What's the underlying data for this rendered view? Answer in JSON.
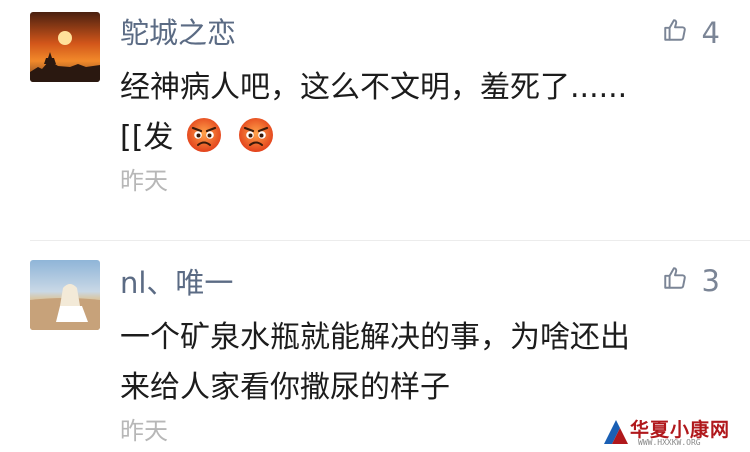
{
  "comments": [
    {
      "username": "鸵城之恋",
      "text_line1": "经神病人吧，这么不文明，羞死了......",
      "text_line2_prefix": "[[发",
      "emoji": [
        "angry-emoji",
        "angry-emoji"
      ],
      "time": "昨天",
      "like_count": "4"
    },
    {
      "username": "nl、唯一",
      "text_line1": "一个矿泉水瓶就能解决的事，为啥还出",
      "text_line2": "来给人家看你撒尿的样子",
      "time": "昨天",
      "like_count": "3"
    }
  ],
  "watermark": {
    "title": "华夏小康网",
    "url": "WWW.HXXKW.ORG"
  },
  "colors": {
    "username": "#5b6b84",
    "text": "#1c1c1c",
    "time": "#b7b7b7",
    "like": "#7b8596",
    "watermark": "#b0181c"
  }
}
